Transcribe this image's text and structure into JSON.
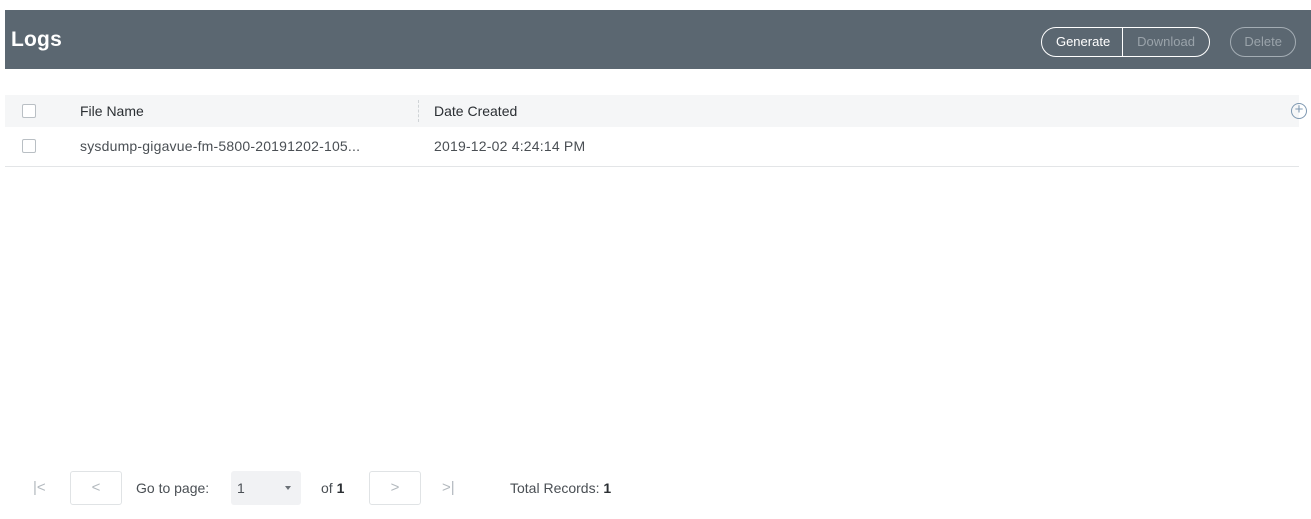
{
  "header": {
    "title": "Logs",
    "buttons": {
      "generate": "Generate",
      "download": "Download",
      "delete": "Delete"
    }
  },
  "table": {
    "columns": {
      "name": "File Name",
      "date": "Date Created"
    },
    "rows": [
      {
        "name": "sysdump-gigavue-fm-5800-20191202-105...",
        "date": "2019-12-02 4:24:14 PM"
      }
    ]
  },
  "pagination": {
    "go_to_label": "Go to page:",
    "current_page": "1",
    "of_label": "of",
    "total_pages": "1",
    "total_records_label": "Total Records:",
    "total_records": "1"
  }
}
